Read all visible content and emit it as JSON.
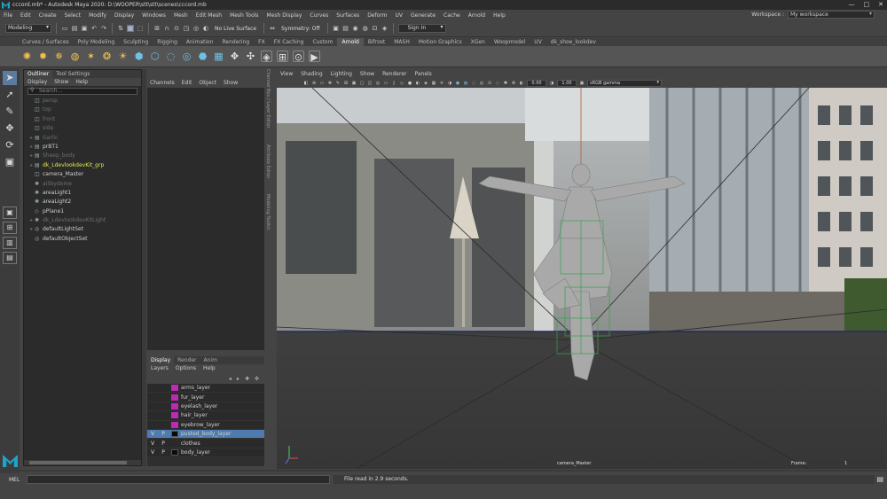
{
  "window": {
    "title": "cccord.mb* - Autodesk Maya 2020: D:\\WOOPER\\stt\\stt\\scenes\\cccord.mb",
    "controls": [
      "—",
      "□",
      "✕"
    ]
  },
  "menubar": {
    "items": [
      "File",
      "Edit",
      "Create",
      "Select",
      "Modify",
      "Display",
      "Windows",
      "Mesh",
      "Edit Mesh",
      "Mesh Tools",
      "Mesh Display",
      "Curves",
      "Surfaces",
      "Deform",
      "UV",
      "Generate",
      "Cache",
      "Arnold",
      "Help"
    ],
    "workspace_label": "Workspace :",
    "workspace_value": "My workspace"
  },
  "statusline": {
    "mode": "Modeling",
    "live_surface": "No Live Surface",
    "symmetry": "Symmetry: Off",
    "sign_in": "Sign In"
  },
  "shelf": {
    "tabs": [
      "Curves / Surfaces",
      "Poly Modeling",
      "Sculpting",
      "Rigging",
      "Animation",
      "Rendering",
      "FX",
      "FX Caching",
      "Custom",
      "Arnold",
      "Bifrost",
      "MASH",
      "Motion Graphics",
      "XGen",
      "Woopmodel",
      "UV",
      "dk_shoe_lookdev"
    ],
    "active_tab": "Arnold"
  },
  "outliner": {
    "tabs": [
      "Outliner",
      "Tool Settings"
    ],
    "menu": [
      "Display",
      "Show",
      "Help"
    ],
    "search_placeholder": "Search...",
    "rows": [
      {
        "label": "persp",
        "style": "dim",
        "icon": "camera-icon",
        "expand": ""
      },
      {
        "label": "top",
        "style": "dim",
        "icon": "camera-icon",
        "expand": ""
      },
      {
        "label": "front",
        "style": "dim",
        "icon": "camera-icon",
        "expand": ""
      },
      {
        "label": "side",
        "style": "dim",
        "icon": "camera-icon",
        "expand": ""
      },
      {
        "label": "Garlic",
        "style": "dim",
        "icon": "group-icon",
        "expand": "+"
      },
      {
        "label": "prBT1",
        "style": "normal",
        "icon": "group-icon",
        "expand": "+"
      },
      {
        "label": "Sheep_body",
        "style": "dim",
        "icon": "group-icon",
        "expand": "+"
      },
      {
        "label": "dk_LdevlookdevKit_grp",
        "style": "hl",
        "icon": "group-icon",
        "expand": "+"
      },
      {
        "label": "camera_Master",
        "style": "normal",
        "icon": "camera-icon",
        "expand": ""
      },
      {
        "label": "aiSkydome",
        "style": "dim",
        "icon": "light-icon",
        "expand": ""
      },
      {
        "label": "areaLight1",
        "style": "normal",
        "icon": "light-icon",
        "expand": ""
      },
      {
        "label": "areaLight2",
        "style": "normal",
        "icon": "light-icon",
        "expand": ""
      },
      {
        "label": "pPlane1",
        "style": "normal",
        "icon": "mesh-icon",
        "expand": ""
      },
      {
        "label": "dk_LdevlookdevKitLight",
        "style": "dim",
        "icon": "light-icon",
        "expand": "+"
      },
      {
        "label": "defaultLightSet",
        "style": "normal",
        "icon": "set-icon",
        "expand": "+"
      },
      {
        "label": "defaultObjectSet",
        "style": "normal",
        "icon": "set-icon",
        "expand": ""
      }
    ]
  },
  "channelbox": {
    "menu": [
      "Channels",
      "Edit",
      "Object",
      "Show"
    ],
    "side_tabs": [
      "Channel Box / Layer Editor",
      "Attribute Editor",
      "Modeling Toolkit"
    ]
  },
  "layers": {
    "tabs": [
      "Display",
      "Render",
      "Anim"
    ],
    "menu": [
      "Layers",
      "Options",
      "Help"
    ],
    "rows": [
      {
        "v": "",
        "p": "",
        "swatch": "magenta",
        "name": "arms_layer",
        "selected": false
      },
      {
        "v": "",
        "p": "",
        "swatch": "magenta",
        "name": "fur_layer",
        "selected": false
      },
      {
        "v": "",
        "p": "",
        "swatch": "magenta",
        "name": "eyelash_layer",
        "selected": false
      },
      {
        "v": "",
        "p": "",
        "swatch": "magenta",
        "name": "hair_layer",
        "selected": false
      },
      {
        "v": "",
        "p": "",
        "swatch": "magenta",
        "name": "eyebrow_layer",
        "selected": false
      },
      {
        "v": "V",
        "p": "P",
        "swatch": "black",
        "name": "pusted_body_layer",
        "selected": true
      },
      {
        "v": "V",
        "p": "P",
        "swatch": "none",
        "name": "clothes",
        "selected": false
      },
      {
        "v": "V",
        "p": "P",
        "swatch": "black",
        "name": "body_layer",
        "selected": false
      }
    ]
  },
  "viewport": {
    "menu": [
      "View",
      "Shading",
      "Lighting",
      "Show",
      "Renderer",
      "Panels"
    ],
    "field_a": "0.00",
    "field_b": "1.00",
    "colorspace": "sRGB gamma",
    "camera_label": "camera_Master",
    "frame_label": "Frame:",
    "frame_value": "1"
  },
  "cmdline": {
    "lang": "MEL",
    "result": "File read in  2.9 seconds."
  },
  "colors": {
    "accent": "#5c7a9e",
    "layer_selected": "#4f7cae",
    "layer_magenta": "#bd2bb4",
    "outliner_highlight": "#e6e94a",
    "maya_blue": "#1fa3c9"
  }
}
